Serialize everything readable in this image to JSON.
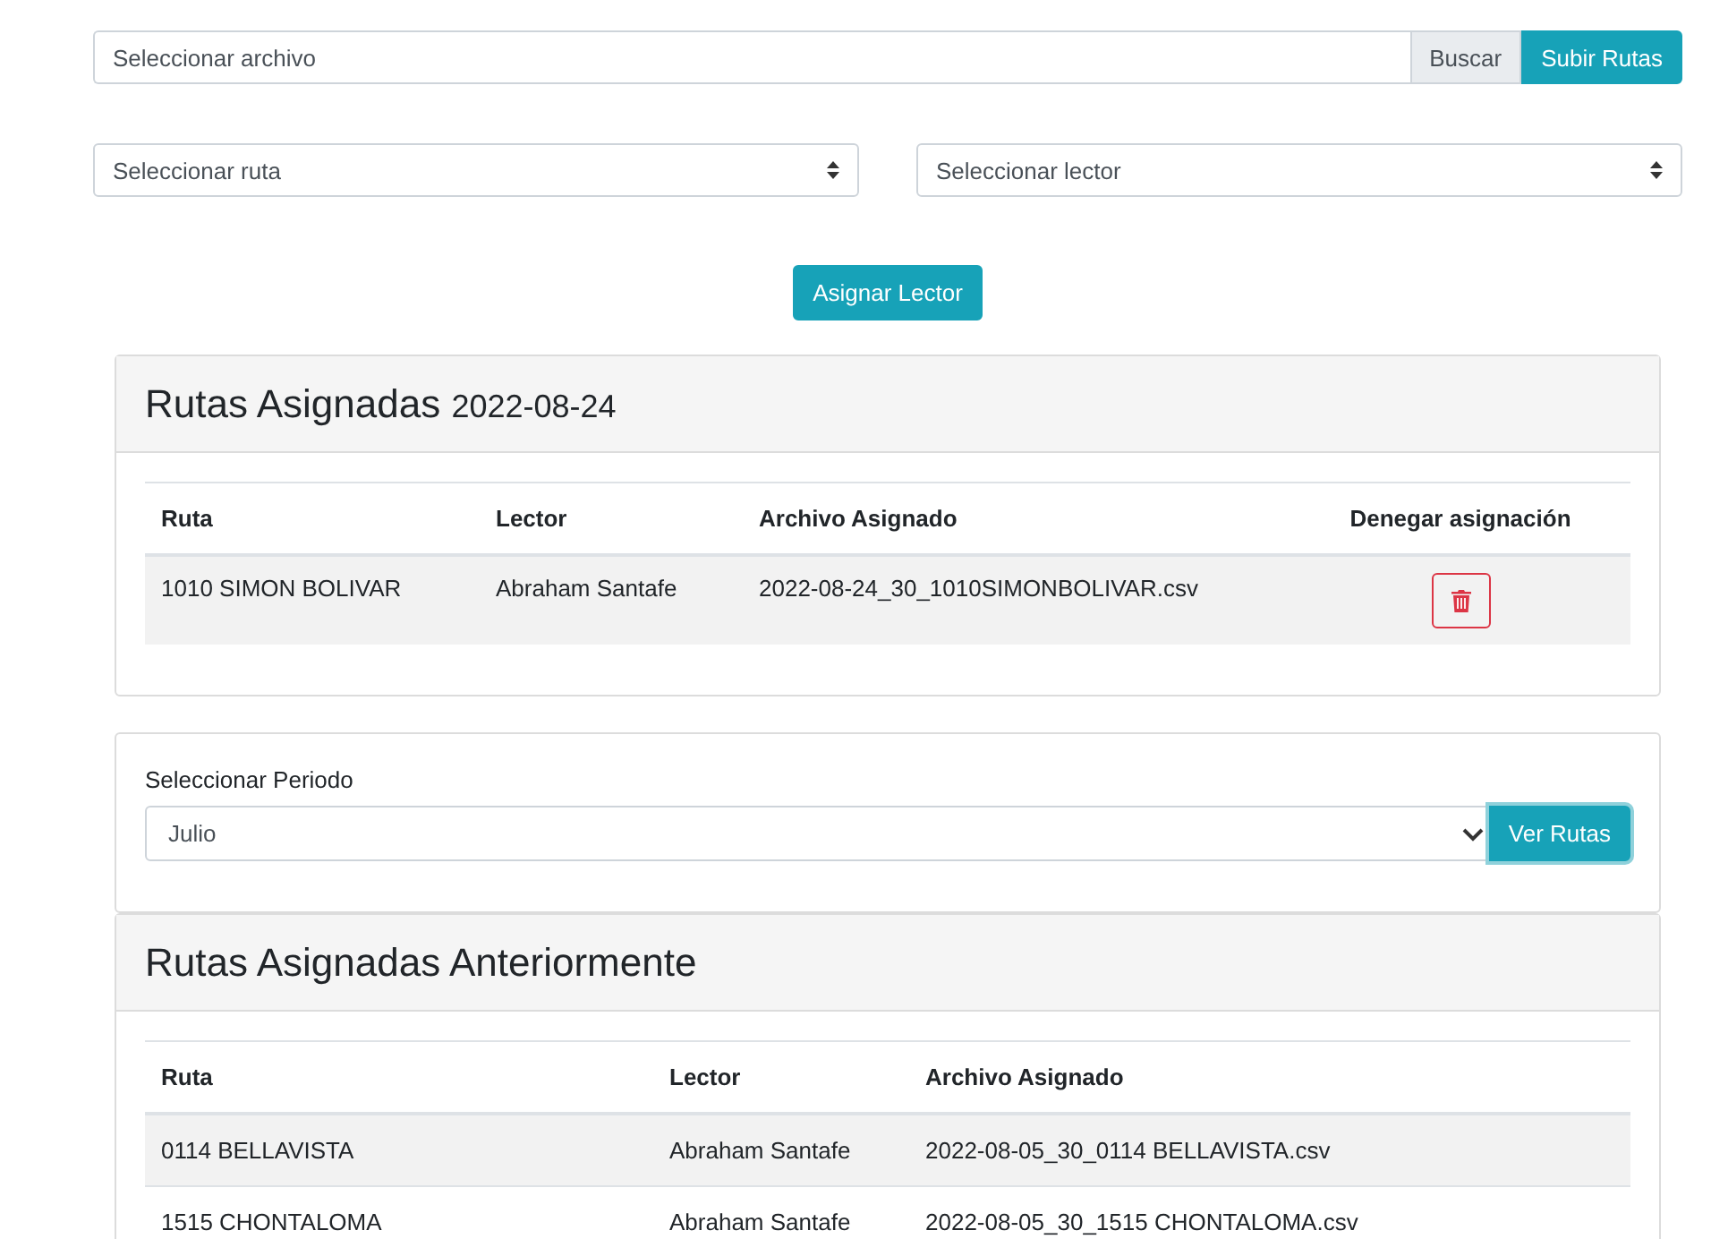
{
  "upload": {
    "placeholder": "Seleccionar archivo",
    "browse_label": "Buscar",
    "submit_label": "Subir Rutas"
  },
  "route_select": {
    "placeholder": "Seleccionar ruta"
  },
  "reader_select": {
    "placeholder": "Seleccionar lector"
  },
  "assign_button": "Asignar Lector",
  "assigned": {
    "title": "Rutas Asignadas",
    "date": "2022-08-24",
    "columns": [
      "Ruta",
      "Lector",
      "Archivo Asignado",
      "Denegar asignación"
    ],
    "rows": [
      {
        "route": "1010 SIMON BOLIVAR",
        "reader": "Abraham Santafe",
        "file": "2022-08-24_30_1010SIMONBOLIVAR.csv"
      }
    ]
  },
  "period": {
    "label": "Seleccionar Periodo",
    "value": "Julio",
    "button": "Ver Rutas"
  },
  "previous": {
    "title": "Rutas Asignadas Anteriormente",
    "columns": [
      "Ruta",
      "Lector",
      "Archivo Asignado"
    ],
    "rows": [
      {
        "route": "0114 BELLAVISTA",
        "reader": "Abraham Santafe",
        "file": "2022-08-05_30_0114 BELLAVISTA.csv"
      },
      {
        "route": "1515 CHONTALOMA",
        "reader": "Abraham Santafe",
        "file": "2022-08-05_30_1515 CHONTALOMA.csv"
      }
    ]
  }
}
